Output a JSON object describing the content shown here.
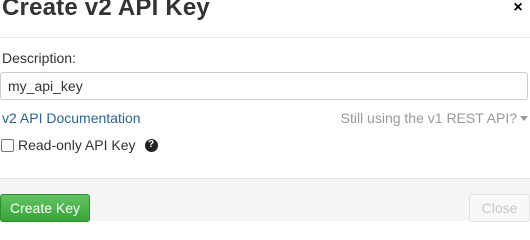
{
  "modal": {
    "title": "Create v2 API Key",
    "close_icon": "close-icon",
    "close_glyph": "×"
  },
  "form": {
    "description_label": "Description:",
    "description_value": "my_api_key",
    "doc_link": "v2 API Documentation",
    "v1_link": "Still using the v1 REST API?",
    "readonly_label": "Read-only API Key",
    "readonly_checked": false,
    "help_glyph": "?"
  },
  "footer": {
    "create_label": "Create Key",
    "close_label": "Close"
  },
  "colors": {
    "primary_green": "#3aa33a",
    "link_blue": "#2a6496",
    "muted_gray": "#999999"
  }
}
